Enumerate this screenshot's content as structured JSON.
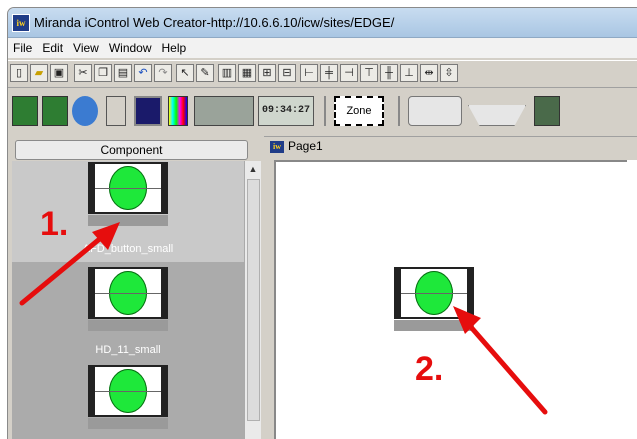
{
  "window": {
    "title": "Miranda iControl Web Creator-http://10.6.6.10/icw/sites/EDGE/",
    "app_icon": "iw"
  },
  "menu": [
    "File",
    "Edit",
    "View",
    "Window",
    "Help"
  ],
  "toolbar2": {
    "clock": "09:34:27",
    "zone": "Zone"
  },
  "component_panel": {
    "header": "Component",
    "items": [
      {
        "label": "AFD_button_small"
      },
      {
        "label": "HD_11_small"
      }
    ]
  },
  "page_tab": {
    "icon": "iw",
    "label": "Page1"
  },
  "annotations": {
    "step1": "1.",
    "step2": "2.",
    "color": "#e60d0d"
  }
}
